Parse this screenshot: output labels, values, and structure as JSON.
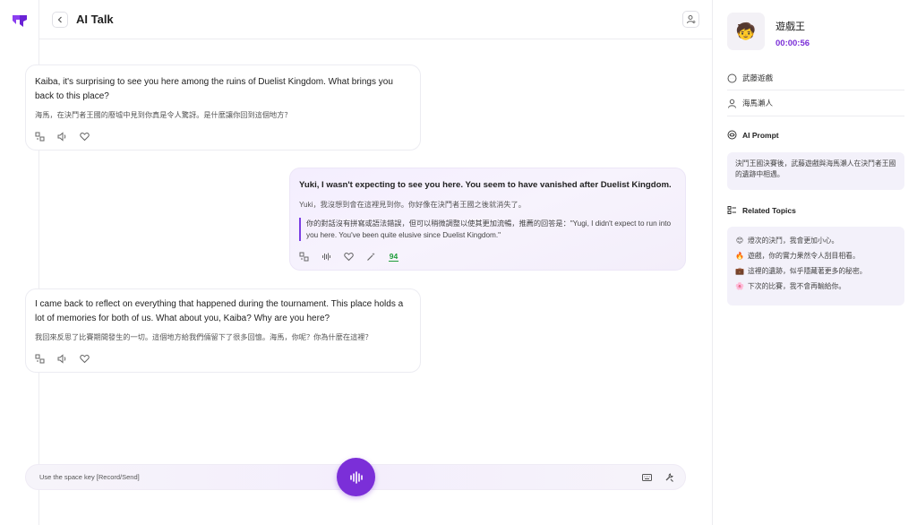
{
  "header": {
    "title": "AI Talk"
  },
  "messages": [
    {
      "role": "ai",
      "en": "Kaiba, it's surprising to see you here among the ruins of Duelist Kingdom. What brings you back to this place?",
      "zh": "海馬，在決鬥者王國的廢墟中見到你真是令人驚訝。是什麼讓你回到這個地方？"
    },
    {
      "role": "user",
      "en": "Yuki, I wasn't expecting to see you here. You seem to have vanished after Duelist Kingdom.",
      "zh": "Yuki，我沒想到會在這裡見到你。你好像在決鬥者王國之後就消失了。",
      "suggestion": "你的對話沒有拼寫或語法錯誤，但可以稍微調整以使其更加流暢，推薦的回答是：\"Yugi, I didn't expect to run into you here. You've been quite elusive since Duelist Kingdom.\"",
      "score": "94"
    },
    {
      "role": "ai",
      "en": "I came back to reflect on everything that happened during the tournament. This place holds a lot of memories for both of us. What about you, Kaiba? Why are you here?",
      "zh": "我回來反思了比賽期間發生的一切。這個地方給我們倆留下了很多回憶。海馬，你呢？你為什麼在這裡？"
    }
  ],
  "input": {
    "hint": "Use the space key [Record/Send]"
  },
  "sidebar": {
    "character_name": "遊戲王",
    "timer": "00:00:56",
    "rows": [
      {
        "icon": "chat-bubble-icon",
        "label": "武藤遊戲"
      },
      {
        "icon": "user-icon",
        "label": "海馬瀨人"
      }
    ],
    "prompt_title": "AI Prompt",
    "prompt_text": "決鬥王國決賽後，武藤遊戲與海馬瀨人在決鬥者王國的遺跡中相遇。",
    "topics_title": "Related Topics",
    "topics": [
      {
        "emoji": "😊",
        "text": "燈次的決鬥，我會更加小心。"
      },
      {
        "emoji": "🔥",
        "text": "遊戲，你的實力果然令人刮目相看。"
      },
      {
        "emoji": "💼",
        "text": "這裡的遺跡，似乎隱藏著更多的秘密。"
      },
      {
        "emoji": "🌸",
        "text": "下次的比賽，我不會再輸給你。"
      }
    ]
  },
  "colors": {
    "accent": "#7b2fd8",
    "score": "#1f9d3a"
  }
}
